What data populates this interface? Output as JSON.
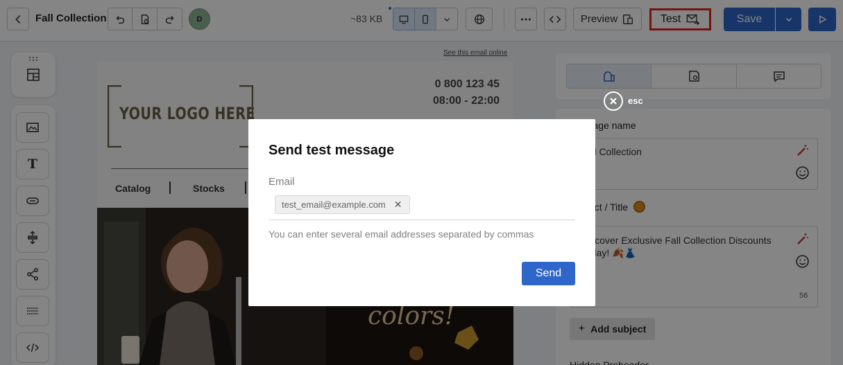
{
  "header": {
    "back_icon": "chevron-left-icon",
    "title": "Fall Collection",
    "avatar_initial": "D",
    "size": "~83 KB",
    "preview_label": "Preview",
    "test_label": "Test",
    "save_label": "Save"
  },
  "email": {
    "see_online": "See this email online",
    "logo_text": "YOUR LOGO HERE",
    "phone": "0 800 123 45",
    "hours": "08:00 - 22:00",
    "nav": [
      "Catalog",
      "Stocks"
    ],
    "hero_text": "colors!"
  },
  "panel": {
    "message_name_label": "Message name",
    "message_name_value": "Fall Collection",
    "subject_label": "Subject / Title",
    "subject_value": "Discover Exclusive Fall Collection Discounts Today! 🍂👗",
    "subject_count": "56",
    "add_subject_label": "Add subject",
    "hidden_preheader_label": "Hidden Preheader"
  },
  "overlay": {
    "esc_label": "esc"
  },
  "modal": {
    "title": "Send test message",
    "email_label": "Email",
    "chip_value": "test_email@example.com",
    "hint": "You can enter several email addresses separated by commas",
    "send_label": "Send"
  },
  "colors": {
    "primary": "#2f66c9",
    "highlight": "#e0231f"
  }
}
